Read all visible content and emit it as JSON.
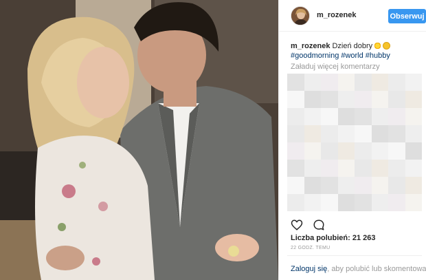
{
  "post": {
    "username": "m_rozenek",
    "follow_label": "Obserwuj",
    "photo_description_icon": "photo"
  },
  "caption": {
    "username": "m_rozenek",
    "text": "Dzień dobry",
    "emojis": [
      "sun-emoji",
      "grinning-emoji"
    ],
    "hashtags": [
      "#goodmorning",
      "#world",
      "#hubby"
    ]
  },
  "comments": {
    "load_more_label": "Załaduj więcej komentarzy"
  },
  "actions": {
    "like_icon": "heart-icon",
    "comment_icon": "comment-icon"
  },
  "stats": {
    "likes_text": "Liczba polubień: 21 263",
    "time_text": "22 GODZ. TEMU"
  },
  "footer": {
    "login_link": "Zaloguj się",
    "login_rest": ", aby polubić lub skomentować."
  },
  "colors": {
    "accent": "#3897f0",
    "hashtag": "#003569",
    "muted": "#999999"
  }
}
